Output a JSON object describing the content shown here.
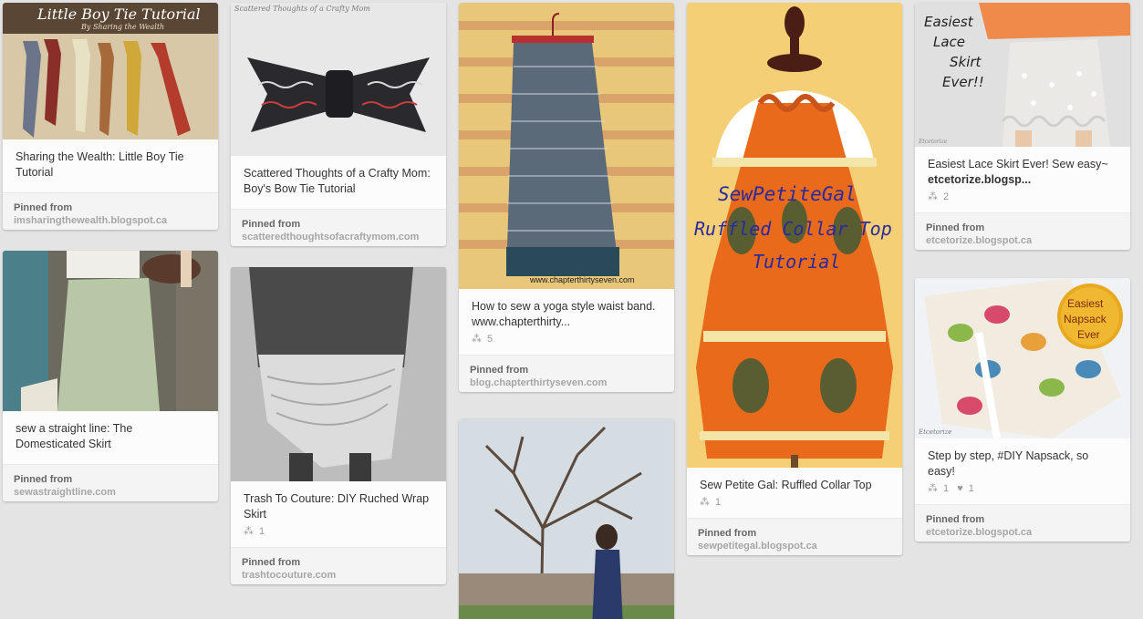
{
  "pins": [
    {
      "image_alt": "Little Boy Tie Tutorial",
      "image_title": "Little Boy Tie Tutorial",
      "image_subtitle": "By Sharing the Wealth",
      "description": "Sharing the Wealth: Little Boy Tie Tutorial",
      "source_label": "Pinned from",
      "source_domain": "imsharingthewealth.blogspot.ca"
    },
    {
      "image_title": "Scattered Thoughts of a Crafty Mom",
      "description": "Scattered Thoughts of a Crafty Mom: Boy's Bow Tie Tutorial",
      "source_label": "Pinned from",
      "source_domain": "scatteredthoughtsofacraftymom.com"
    },
    {
      "image_caption": "www.chapterthirtyseven.com",
      "description_lead": "How to sew a yoga style waist band. ",
      "description_bold": "www.chapterthirty...",
      "repins": "5",
      "source_label": "Pinned from",
      "source_domain": "blog.chapterthirtyseven.com"
    },
    {
      "image_overlay_line1": "SewPetiteGal",
      "image_overlay_line2": "Ruffled Collar Top",
      "image_overlay_line3": "Tutorial",
      "description": "Sew Petite Gal: Ruffled Collar Top",
      "repins": "1",
      "source_label": "Pinned from",
      "source_domain": "sewpetitegal.blogspot.ca"
    },
    {
      "image_overlay_line1": "Easiest",
      "image_overlay_line2": "Lace",
      "image_overlay_line3": "Skirt",
      "image_overlay_line4": "Ever!!",
      "image_watermark": "Etcetorize",
      "description_lead": "Easiest Lace Skirt Ever! Sew easy~ ",
      "description_bold": "etcetorize.blogsp...",
      "repins": "2",
      "source_label": "Pinned from",
      "source_domain": "etcetorize.blogspot.ca"
    },
    {
      "description": "sew a straight line: The Domesticated Skirt",
      "source_label": "Pinned from",
      "source_domain": "sewastraightline.com"
    },
    {
      "description": "Trash To Couture: DIY Ruched Wrap Skirt",
      "repins": "1",
      "source_label": "Pinned from",
      "source_domain": "trashtocouture.com"
    },
    {
      "image_badge_line1": "Easiest",
      "image_badge_line2": "Napsack",
      "image_badge_line3": "Ever",
      "image_watermark": "Etcetorize",
      "description": "Step by step, #DIY Napsack, so easy!",
      "repins": "1",
      "likes": "1",
      "source_label": "Pinned from",
      "source_domain": "etcetorize.blogspot.ca"
    }
  ],
  "icons": {
    "repin": "repin-icon",
    "like": "heart-icon"
  },
  "colors": {
    "background": "#e4e4e4",
    "card": "#ffffff",
    "text": "#333333",
    "muted": "#9a9a9a"
  }
}
